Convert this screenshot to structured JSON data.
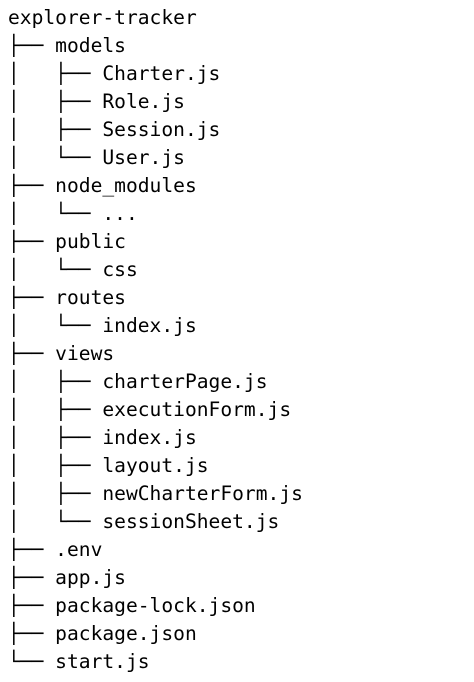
{
  "tree": {
    "root": "explorer-tracker",
    "lines": [
      "├── models",
      "│   ├── Charter.js",
      "│   ├── Role.js",
      "│   ├── Session.js",
      "│   └── User.js",
      "├── node_modules",
      "│   └── ...",
      "├── public",
      "│   └── css",
      "├── routes",
      "│   └── index.js",
      "├── views",
      "│   ├── charterPage.js",
      "│   ├── executionForm.js",
      "│   ├── index.js",
      "│   ├── layout.js",
      "│   ├── newCharterForm.js",
      "│   └── sessionSheet.js",
      "├── .env",
      "├── app.js",
      "├── package-lock.json",
      "├── package.json",
      "└── start.js"
    ]
  }
}
